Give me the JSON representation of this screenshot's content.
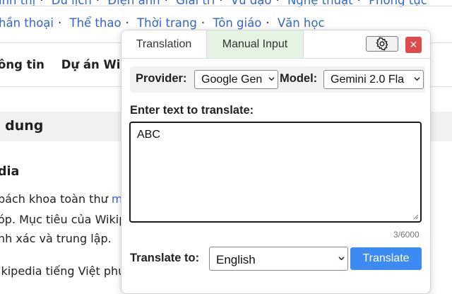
{
  "wiki": {
    "categories_top": [
      "ình thị",
      "Du lịch",
      "Điện ảnh",
      "Giải trí",
      "Vũ đạo",
      "Nghệ thuật",
      "Phong tục"
    ],
    "categories_mid": [
      "hần thoại",
      "Thể thao",
      "Thời trang",
      "Tôn giáo",
      "Văn học"
    ],
    "nav": [
      "ông tin",
      "Dự án Wiki"
    ],
    "toc_title": "i dung",
    "section_title": "dia",
    "para1_text": "bách khoa toàn thư ",
    "para1_link": "m",
    "para2": "óp. Mục tiêu của Wikip",
    "para3": "nh xác và trung lập.",
    "para4": "ikipedia tiếng Việt phụ"
  },
  "popup": {
    "tabs": [
      "Translation",
      "Manual Input"
    ],
    "active_tab": "Manual Input",
    "settings_icon": "gear-icon",
    "close_icon": "close-icon",
    "close_glyph": "✕",
    "provider_label": "Provider:",
    "provider_value": "Google Gen",
    "model_label": "Model:",
    "model_value": "Gemini 2.0 Fla",
    "input_label": "Enter text to translate:",
    "input_value": "ABC",
    "char_count": "3/6000",
    "target_label": "Translate to:",
    "target_value": "English",
    "translate_button": "Translate"
  },
  "colors": {
    "link": "#3366cc",
    "manual_tab_bg": "#e5f4e2",
    "close_bg": "#e04a4a",
    "translate_bg": "#3d8bf2"
  }
}
